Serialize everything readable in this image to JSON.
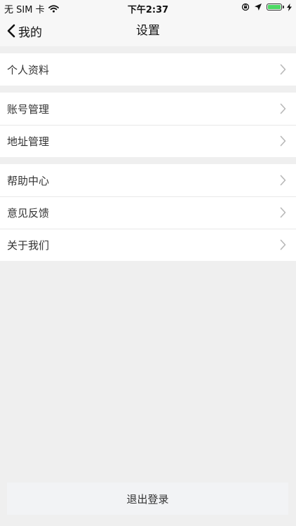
{
  "status_bar": {
    "carrier": "无 SIM 卡",
    "time": "下午2:37",
    "battery_level": 1.0,
    "battery_color": "#4cd964"
  },
  "nav": {
    "back_label": "我的",
    "title": "设置"
  },
  "groups": [
    {
      "items": [
        {
          "label": "个人资料"
        }
      ]
    },
    {
      "items": [
        {
          "label": "账号管理"
        },
        {
          "label": "地址管理"
        }
      ]
    },
    {
      "items": [
        {
          "label": "帮助中心"
        },
        {
          "label": "意见反馈"
        },
        {
          "label": "关于我们"
        }
      ]
    }
  ],
  "logout_label": "退出登录",
  "icons": {
    "back": "chevron-left-icon",
    "row": "chevron-right-icon",
    "wifi": "wifi-icon",
    "lock": "orientation-lock-icon",
    "location": "location-arrow-icon",
    "battery": "battery-icon",
    "charging": "charging-bolt-icon"
  }
}
